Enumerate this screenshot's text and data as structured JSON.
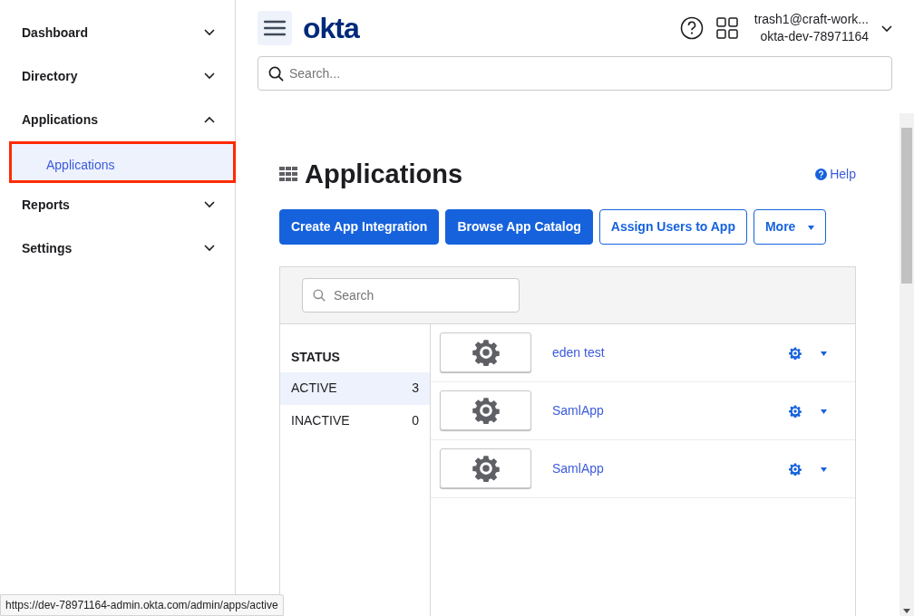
{
  "sidebar": {
    "items": [
      {
        "label": "Dashboard",
        "expanded": false
      },
      {
        "label": "Directory",
        "expanded": false
      },
      {
        "label": "Applications",
        "expanded": true,
        "children": [
          {
            "label": "Applications",
            "selected": true,
            "highlighted": true
          }
        ]
      },
      {
        "label": "Reports",
        "expanded": false
      },
      {
        "label": "Settings",
        "expanded": false
      }
    ]
  },
  "header": {
    "logo": "okta",
    "user_email": "trash1@craft-work...",
    "org": "okta-dev-78971164"
  },
  "global_search": {
    "placeholder": "Search..."
  },
  "page": {
    "title": "Applications",
    "help": "Help",
    "buttons": [
      {
        "label": "Create App Integration",
        "kind": "primary"
      },
      {
        "label": "Browse App Catalog",
        "kind": "primary"
      },
      {
        "label": "Assign Users to App",
        "kind": "outline"
      },
      {
        "label": "More",
        "kind": "dropdown"
      }
    ],
    "app_search": {
      "placeholder": "Search"
    },
    "filter": {
      "heading": "STATUS",
      "items": [
        {
          "label": "ACTIVE",
          "count": "3",
          "selected": true
        },
        {
          "label": "INACTIVE",
          "count": "0",
          "selected": false
        }
      ]
    },
    "apps": [
      {
        "name": "eden test"
      },
      {
        "name": "SamlApp"
      },
      {
        "name": "SamlApp"
      }
    ]
  },
  "status_url": "https://dev-78971164-admin.okta.com/admin/apps/active"
}
